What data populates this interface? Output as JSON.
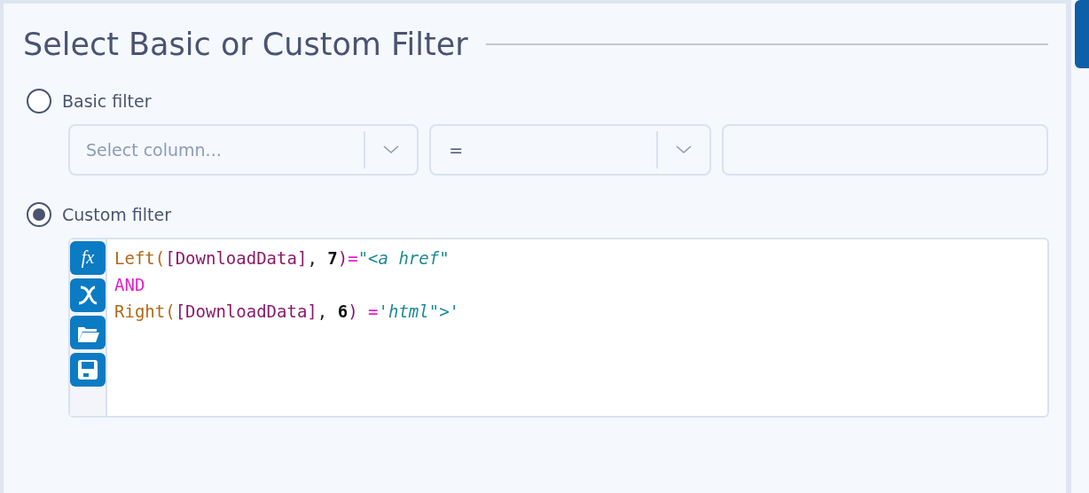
{
  "title": "Select Basic or Custom Filter",
  "options": [
    {
      "label": "Basic filter",
      "selected": false
    },
    {
      "label": "Custom filter",
      "selected": true
    }
  ],
  "basic_filter": {
    "column_select": {
      "placeholder": "Select column..."
    },
    "operator_select": {
      "value": "="
    }
  },
  "editor": {
    "tools": [
      {
        "kind": "function",
        "label": "fx"
      },
      {
        "kind": "variable"
      },
      {
        "kind": "open"
      },
      {
        "kind": "save"
      }
    ],
    "lines": [
      [
        {
          "kind": "func",
          "text": "Left"
        },
        {
          "kind": "paren",
          "text": "("
        },
        {
          "kind": "field",
          "text": "[DownloadData]"
        },
        {
          "kind": "punct",
          "text": ", "
        },
        {
          "kind": "number",
          "text": "7"
        },
        {
          "kind": "paren2",
          "text": ")"
        },
        {
          "kind": "operator",
          "text": "="
        },
        {
          "kind": "string",
          "text": "\"<a href\""
        }
      ],
      [
        {
          "kind": "keyword",
          "text": "AND"
        }
      ],
      [
        {
          "kind": "func",
          "text": "Right"
        },
        {
          "kind": "paren",
          "text": "("
        },
        {
          "kind": "field",
          "text": "[DownloadData]"
        },
        {
          "kind": "punct",
          "text": ", "
        },
        {
          "kind": "number",
          "text": "6"
        },
        {
          "kind": "paren2",
          "text": ") "
        },
        {
          "kind": "operator",
          "text": "="
        },
        {
          "kind": "string",
          "text": "'html\">'"
        }
      ]
    ]
  }
}
